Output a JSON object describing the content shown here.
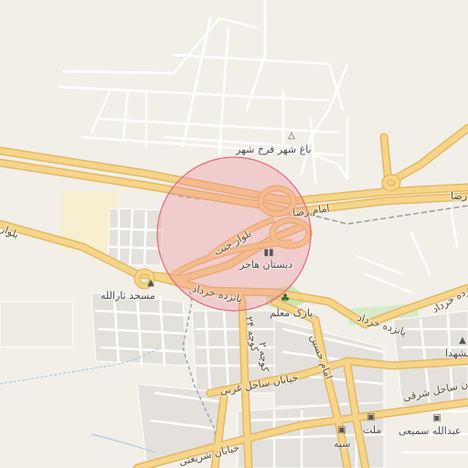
{
  "map": {
    "search_circle_color": "#f08a96",
    "park_color": "#c8e6b0",
    "road_color": "#f6d58a",
    "road_casing_color": "#e3b862"
  },
  "labels": {
    "bagh_shahr": "باغ شهر فرخ شهر",
    "imam_reza_1": "امام رضا",
    "imam_reza_2": "امام رضا",
    "imam_reza_3": "رضا",
    "bolvar_janat": "بلوار جنت",
    "bolvar_left": "بلوار",
    "dabestan": "دبستان هاجر",
    "masjed": "مسجد ثارالله",
    "panzdah_1": "پانزده خرداد",
    "panzdah_2": "پانزده خرداد",
    "panzdah_3": "پانزده خرداد",
    "park_moalem": "پارک معلم",
    "kooche_24": "کوچه ۲۴",
    "kooche_2": "کوچه ۲",
    "imam_hossein": "امام حسین",
    "khiaban_sahel_gharbi": "خیابان ساحل غربی",
    "khiaban_sahel_sharghi": "خیابان ساحل شرقی",
    "shohada": "الشهدا",
    "melat": "ملت",
    "sepah": "سپه",
    "abdollah": "عبدالله سمیعی",
    "khiaban_shariati": "خیابان شریعتی"
  },
  "icons": {
    "peak": "peak-icon",
    "school": "school-icon",
    "mosque": "mosque-icon",
    "tree": "park-tree-icon",
    "cinema": "cinema-icon",
    "bank": "bank-icon"
  }
}
